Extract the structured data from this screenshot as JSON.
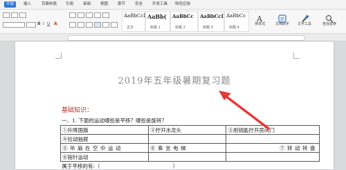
{
  "menubar": {
    "tabs": [
      "开始",
      "插入",
      "页面布局",
      "引用",
      "审阅",
      "视图",
      "章节",
      "安全",
      "开发工具",
      "特色应用"
    ],
    "active_tab": "开始"
  },
  "ribbon": {
    "styles": [
      {
        "sample": "AaBbCcDd",
        "label": "正文"
      },
      {
        "sample": "AaBb(",
        "label": "标题 1"
      },
      {
        "sample": "AaBbCc",
        "label": "标题 2"
      },
      {
        "sample": "AaBbCcI",
        "label": "标题 3"
      },
      {
        "sample": "AaBbCc",
        "label": "标题 4"
      }
    ],
    "buttons": [
      {
        "label": "新样式",
        "icon": "new-style-icon"
      },
      {
        "label": "文档助手",
        "icon": "doc-assistant-icon"
      },
      {
        "label": "文字工具",
        "icon": "text-tools-icon"
      },
      {
        "label": "查找替换",
        "icon": "find-replace-icon"
      }
    ]
  },
  "document": {
    "title": "2019年五年级暑期复习题",
    "section_heading": "基础知识：",
    "question": "一、1. 下面的运动哪些是平移？哪些是旋转？",
    "table": {
      "rows": [
        [
          "①升降国旗",
          "②拧开水龙头",
          "③用钥匙拧开房间门"
        ],
        [
          "④拉动抽屉",
          "",
          ""
        ],
        [
          "⑤吊扇在空中运动",
          "⑥乘坐电梯",
          "⑦转动转盘"
        ],
        [
          "⑧指针运动",
          "",
          ""
        ],
        [
          "属于平移的有:（　　　　　　　　　　　　　　）",
          "",
          ""
        ]
      ]
    }
  },
  "annotation": {
    "arrow_color": "#e53935"
  },
  "colors": {
    "accent": "#2e75d6",
    "heading_red": "#c0312b"
  }
}
